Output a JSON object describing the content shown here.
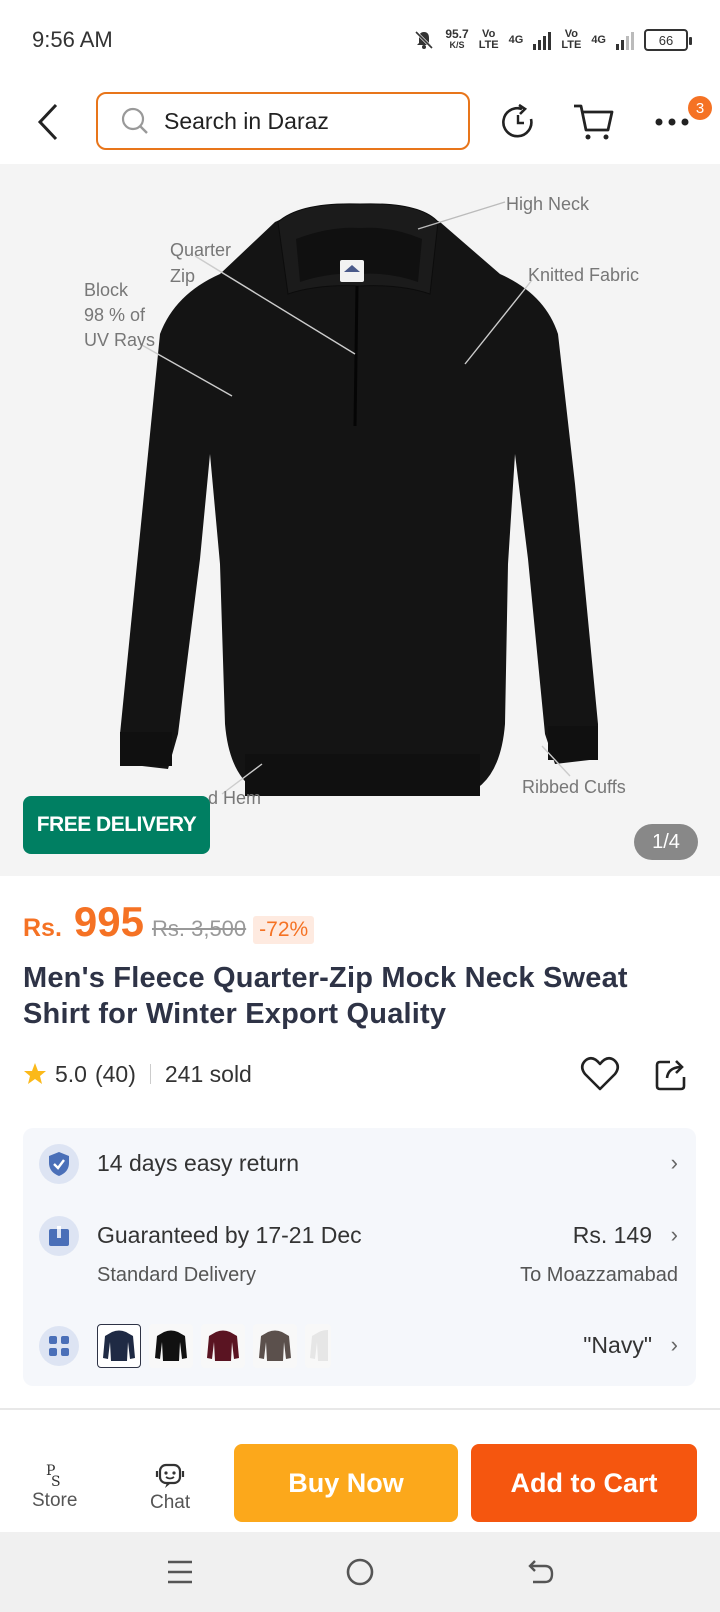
{
  "status": {
    "time": "9:56 AM",
    "net_speed_value": "95.7",
    "net_speed_unit": "K/S",
    "sim1_top": "Vo",
    "sim1_bottom": "LTE",
    "sim1_gen": "4G",
    "sim2_top": "Vo",
    "sim2_bottom": "LTE",
    "sim2_gen": "4G",
    "battery": "66"
  },
  "header": {
    "search_placeholder": "Search in Daraz",
    "cart_badge": "3"
  },
  "gallery": {
    "callouts": {
      "high_neck": "High Neck",
      "quarter_zip_1": "Quarter",
      "quarter_zip_2": "Zip",
      "knitted": "Knitted Fabric",
      "block_1": "Block",
      "block_2": "98 % of",
      "block_3": "UV Rays",
      "hem": "d Hem",
      "cuffs": "Ribbed Cuffs"
    },
    "free_delivery": "FREE DELIVERY",
    "counter": "1/4"
  },
  "product": {
    "currency": "Rs.",
    "price": "995",
    "old_price": "Rs. 3,500",
    "discount": "-72%",
    "title": "Men's Fleece Quarter-Zip Mock Neck Sweat Shirt for Winter Export Quality",
    "rating": "5.0",
    "reviews": "(40)",
    "sold": "241 sold"
  },
  "info": {
    "returns": "14 days easy return",
    "delivery_title": "Guaranteed by 17-21 Dec",
    "delivery_type": "Standard Delivery",
    "delivery_price": "Rs. 149",
    "delivery_to": "To Moazzamabad",
    "variant_selected": "\"Navy\"",
    "variant_colors": [
      "#1f2a44",
      "#111111",
      "#5a1422",
      "#5b504c",
      "#eeeeee"
    ]
  },
  "bottom": {
    "store": "Store",
    "chat": "Chat",
    "buy_now": "Buy Now",
    "add_to_cart": "Add to Cart"
  }
}
